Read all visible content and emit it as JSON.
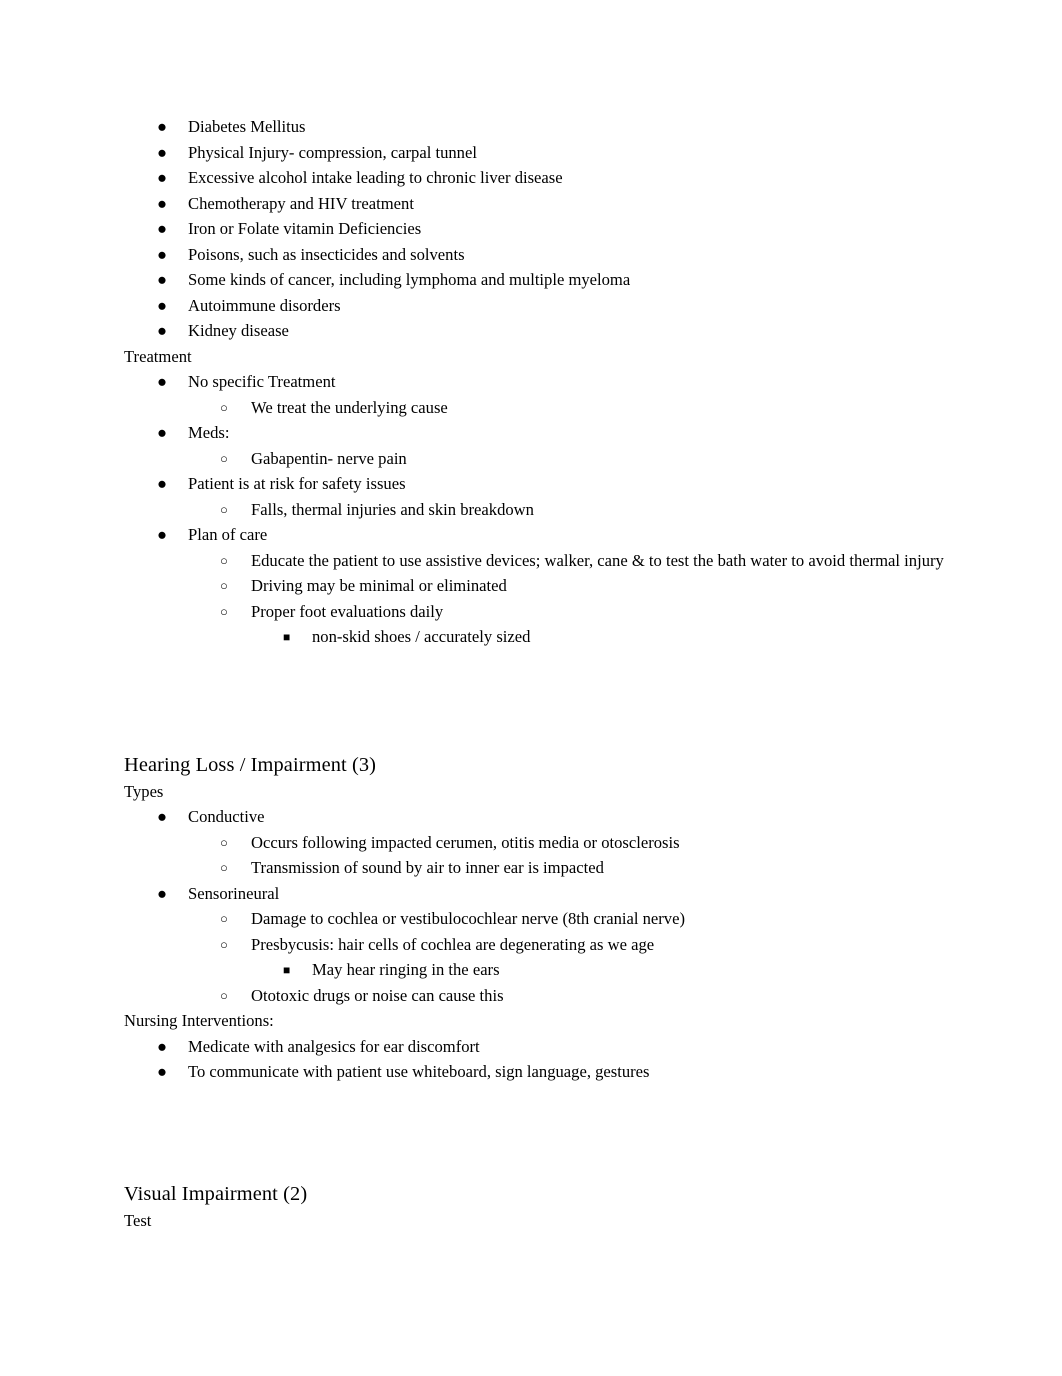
{
  "document": {
    "background_color": "#ffffff",
    "text_color": "#000000",
    "bullet_glyphs": {
      "level1": "●",
      "level2": "○",
      "level3": "■"
    }
  },
  "sections": {
    "causes_list": {
      "items": [
        "Diabetes Mellitus",
        "Physical Injury- compression, carpal tunnel",
        "Excessive alcohol intake leading to chronic liver disease",
        "Chemotherapy and HIV treatment",
        "Iron or Folate vitamin Deficiencies",
        "Poisons, such as insecticides and solvents",
        "Some kinds of cancer, including lymphoma and multiple myeloma",
        "Autoimmune disorders",
        "Kidney disease"
      ]
    },
    "treatment": {
      "label": "Treatment",
      "items": {
        "no_specific_treatment": "No specific Treatment",
        "underlying_cause": "We treat the underlying cause",
        "meds": "Meds:",
        "gabapentin": "Gabapentin- nerve pain",
        "safety_risk": "Patient is at risk for safety issues",
        "safety_detail": "Falls, thermal injuries and skin breakdown",
        "plan_of_care": "Plan of care",
        "educate": "Educate the patient to use assistive devices; walker, cane & to test the bath water to avoid thermal injury",
        "driving": "Driving may be minimal or eliminated",
        "foot_eval": "Proper foot evaluations daily",
        "shoes": "non-skid shoes / accurately sized"
      }
    },
    "hearing_loss": {
      "heading": "Hearing Loss / Impairment (3)",
      "types_label": "Types",
      "conductive": {
        "label": "Conductive",
        "details": [
          "Occurs following impacted cerumen, otitis media or otosclerosis",
          "Transmission of sound by air to inner ear is impacted"
        ]
      },
      "sensorineural": {
        "label": "Sensorineural",
        "damage": "Damage to cochlea or vestibulocochlear nerve (8th cranial nerve)",
        "presbycusis": "Presbycusis: hair cells of cochlea are degenerating as we age",
        "ringing": "May hear ringing in the ears",
        "ototoxic": "Ototoxic drugs or noise can cause this"
      },
      "nursing_label": "Nursing Interventions:",
      "nursing_items": [
        "Medicate with analgesics for ear discomfort",
        "To communicate with patient use whiteboard, sign language, gestures"
      ]
    },
    "visual_impairment": {
      "heading": "Visual Impairment (2)",
      "test_label": "Test"
    }
  }
}
